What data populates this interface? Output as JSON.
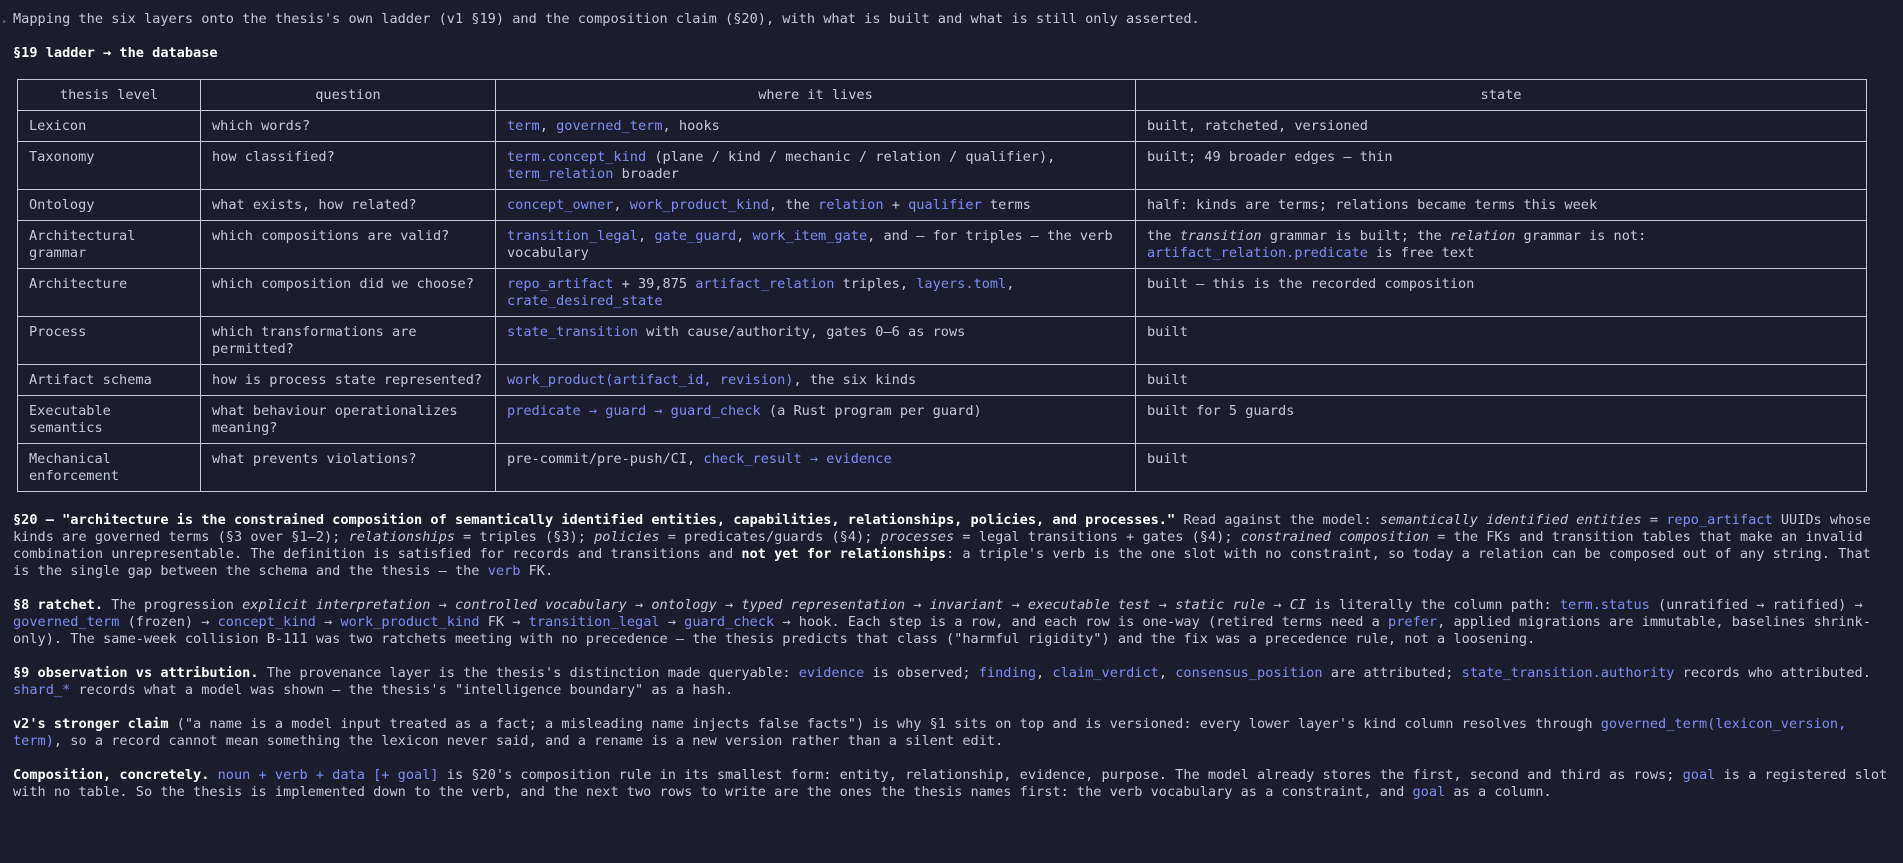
{
  "intro": "Mapping the six layers onto the thesis's own ladder (v1 §19) and the composition claim (§20), with what is built and what is still only asserted.",
  "heading": "§19 ladder → the database",
  "table": {
    "headers": [
      "thesis level",
      "question",
      "where it lives",
      "state"
    ],
    "rows": [
      {
        "level": "Lexicon",
        "question": "which words?",
        "where": [
          {
            "t": "term",
            "c": 1
          },
          {
            "t": ", "
          },
          {
            "t": "governed_term",
            "c": 1
          },
          {
            "t": ", hooks"
          }
        ],
        "state": [
          {
            "t": "built, ratcheted, versioned"
          }
        ]
      },
      {
        "level": "Taxonomy",
        "question": "how classified?",
        "where": [
          {
            "t": "term.concept_kind",
            "c": 1
          },
          {
            "t": " (plane / kind / mechanic / relation / qualifier),"
          },
          {
            "br": 1
          },
          {
            "t": "term_relation",
            "c": 1
          },
          {
            "t": " broader"
          }
        ],
        "state": [
          {
            "t": "built; 49 broader edges — thin"
          }
        ]
      },
      {
        "level": "Ontology",
        "question": "what exists, how related?",
        "where": [
          {
            "t": "concept_owner",
            "c": 1
          },
          {
            "t": ", "
          },
          {
            "t": "work_product_kind",
            "c": 1
          },
          {
            "t": ", the "
          },
          {
            "t": "relation",
            "c": 1
          },
          {
            "t": " + "
          },
          {
            "t": "qualifier",
            "c": 1
          },
          {
            "t": " terms"
          }
        ],
        "state": [
          {
            "t": "half: kinds are terms; relations became terms this week"
          }
        ]
      },
      {
        "level": "Architectural grammar",
        "question": "which compositions are valid?",
        "where": [
          {
            "t": "transition_legal",
            "c": 1
          },
          {
            "t": ", "
          },
          {
            "t": "gate_guard",
            "c": 1
          },
          {
            "t": ", "
          },
          {
            "t": "work_item_gate",
            "c": 1
          },
          {
            "t": ", and — for triples — the verb vocabulary"
          }
        ],
        "state": [
          {
            "t": "the "
          },
          {
            "t": "transition",
            "i": 1
          },
          {
            "t": " grammar is built; the "
          },
          {
            "t": "relation",
            "i": 1
          },
          {
            "t": " grammar is not:"
          },
          {
            "br": 1
          },
          {
            "t": "artifact_relation.predicate",
            "c": 1
          },
          {
            "t": " is free text"
          }
        ]
      },
      {
        "level": "Architecture",
        "question": "which composition did we choose?",
        "where": [
          {
            "t": "repo_artifact",
            "c": 1
          },
          {
            "t": " + 39,875 "
          },
          {
            "t": "artifact_relation",
            "c": 1
          },
          {
            "t": " triples, "
          },
          {
            "t": "layers.toml",
            "c": 1
          },
          {
            "t": ","
          },
          {
            "br": 1
          },
          {
            "t": "crate_desired_state",
            "c": 1
          }
        ],
        "state": [
          {
            "t": "built — this is the recorded composition"
          }
        ]
      },
      {
        "level": "Process",
        "question": "which transformations are permitted?",
        "where": [
          {
            "t": "state_transition",
            "c": 1
          },
          {
            "t": " with cause/authority, gates 0–6 as rows"
          }
        ],
        "state": [
          {
            "t": "built"
          }
        ]
      },
      {
        "level": "Artifact schema",
        "question": "how is process state represented?",
        "where": [
          {
            "t": "work_product(artifact_id, revision)",
            "c": 1
          },
          {
            "t": ", the six kinds"
          }
        ],
        "state": [
          {
            "t": "built"
          }
        ]
      },
      {
        "level": "Executable semantics",
        "question": "what behaviour operationalizes meaning?",
        "where": [
          {
            "t": "predicate → guard → guard_check",
            "c": 1
          },
          {
            "t": " (a Rust program per guard)"
          }
        ],
        "state": [
          {
            "t": "built for 5 guards"
          }
        ]
      },
      {
        "level": "Mechanical enforcement",
        "question": "what prevents violations?",
        "where": [
          {
            "t": "pre-commit/pre-push/CI, "
          },
          {
            "t": "check_result → evidence",
            "c": 1
          }
        ],
        "state": [
          {
            "t": "built"
          }
        ]
      }
    ]
  },
  "paragraphs": [
    [
      {
        "t": "§20 — \"architecture is the constrained composition of semantically identified entities, capabilities, relationships, policies, and processes.\"",
        "b": 1
      },
      {
        "t": " Read against the model: "
      },
      {
        "t": "semantically identified entities",
        "i": 1
      },
      {
        "t": " = "
      },
      {
        "t": "repo_artifact",
        "c": 1
      },
      {
        "t": " UUIDs whose kinds are governed terms (§3 over §1–2); "
      },
      {
        "t": "relationships",
        "i": 1
      },
      {
        "t": " = triples (§3); "
      },
      {
        "t": "policies",
        "i": 1
      },
      {
        "t": " = predicates/guards (§4); "
      },
      {
        "t": "processes",
        "i": 1
      },
      {
        "t": " = legal transitions + gates (§4); "
      },
      {
        "t": "constrained composition",
        "i": 1
      },
      {
        "t": " = the FKs and transition tables that make an invalid combination unrepresentable. The definition is satisfied for records and transitions and "
      },
      {
        "t": "not yet for relationships",
        "b": 1
      },
      {
        "t": ": a triple's verb is the one slot with no constraint, so today a relation can be composed out of any string. That is the single gap between the schema and the thesis — the "
      },
      {
        "t": "verb",
        "c": 1
      },
      {
        "t": " FK."
      }
    ],
    [
      {
        "t": "§8 ratchet.",
        "b": 1
      },
      {
        "t": " The progression "
      },
      {
        "t": "explicit interpretation → controlled vocabulary → ontology → typed representation → invariant → executable test → static rule → CI",
        "i": 1
      },
      {
        "t": " is literally the column path: "
      },
      {
        "t": "term.status",
        "c": 1
      },
      {
        "t": " (unratified → ratified) → "
      },
      {
        "t": "governed_term",
        "c": 1
      },
      {
        "t": " (frozen) → "
      },
      {
        "t": "concept_kind",
        "c": 1
      },
      {
        "t": " → "
      },
      {
        "t": "work_product_kind",
        "c": 1
      },
      {
        "t": " FK → "
      },
      {
        "t": "transition_legal",
        "c": 1
      },
      {
        "t": " → "
      },
      {
        "t": "guard_check",
        "c": 1
      },
      {
        "t": " → hook. Each step is a row, and each row is one-way (retired terms need a "
      },
      {
        "t": "prefer",
        "c": 1
      },
      {
        "t": ", applied migrations are immutable, baselines shrink-only). The same-week collision B-111 was two ratchets meeting with no precedence — the thesis predicts that class (\"harmful rigidity\") and the fix was a precedence rule, not a loosening."
      }
    ],
    [
      {
        "t": "§9 observation vs attribution.",
        "b": 1
      },
      {
        "t": " The provenance layer is the thesis's distinction made queryable: "
      },
      {
        "t": "evidence",
        "c": 1
      },
      {
        "t": " is observed; "
      },
      {
        "t": "finding",
        "c": 1
      },
      {
        "t": ", "
      },
      {
        "t": "claim_verdict",
        "c": 1
      },
      {
        "t": ", "
      },
      {
        "t": "consensus_position",
        "c": 1
      },
      {
        "t": " are attributed; "
      },
      {
        "t": "state_transition.authority",
        "c": 1
      },
      {
        "t": " records who attributed. "
      },
      {
        "t": "shard_*",
        "c": 1
      },
      {
        "t": " records what a model was shown — the thesis's \"intelligence boundary\" as a hash."
      }
    ],
    [
      {
        "t": "v2's stronger claim",
        "b": 1
      },
      {
        "t": " (\"a name is a model input treated as a fact; a misleading name injects false facts\") is why §1 sits on top and is versioned: every lower layer's kind column resolves through "
      },
      {
        "t": "governed_term(lexicon_version, term)",
        "c": 1
      },
      {
        "t": ", so a record cannot mean something the lexicon never said, and a rename is a new version rather than a silent edit."
      }
    ],
    [
      {
        "t": "Composition, concretely.",
        "b": 1
      },
      {
        "t": " "
      },
      {
        "t": "noun + verb + data [+ goal]",
        "c": 1
      },
      {
        "t": " is §20's composition rule in its smallest form: entity, relationship, evidence, purpose. The model already stores the first, second and third as rows; "
      },
      {
        "t": "goal",
        "c": 1
      },
      {
        "t": " is a registered slot with no table. So the thesis is implemented down to the verb, and the next two rows to write are the ones the thesis names first: the verb vocabulary as a constraint, and "
      },
      {
        "t": "goal",
        "c": 1
      },
      {
        "t": " as a column."
      }
    ]
  ]
}
